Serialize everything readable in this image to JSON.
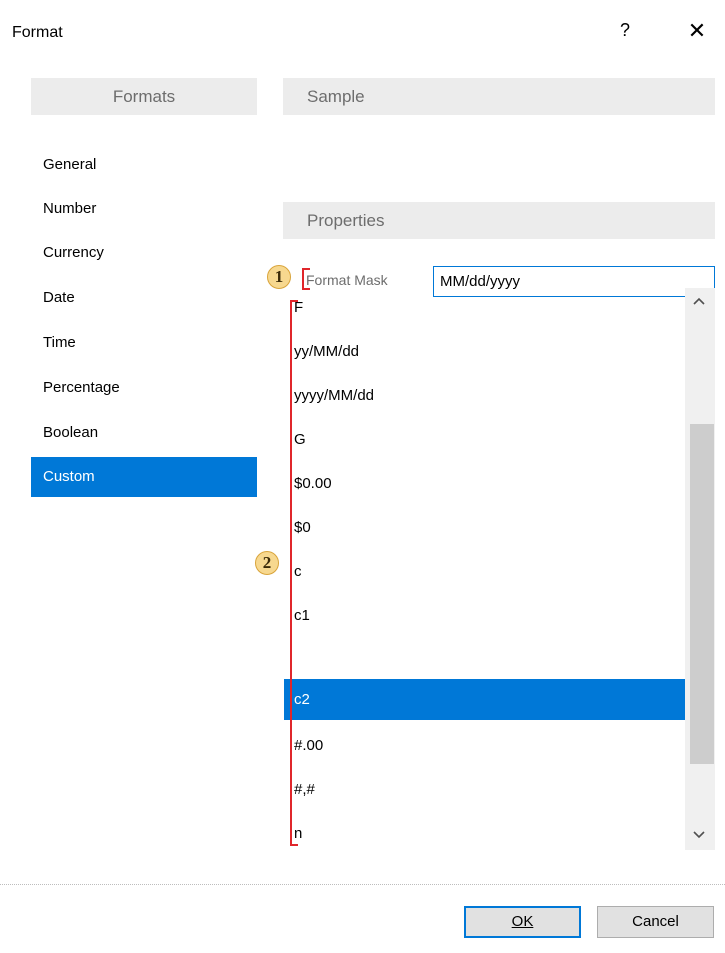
{
  "window": {
    "title": "Format",
    "help_label": "?",
    "close_label": "✕"
  },
  "formats": {
    "header": "Formats",
    "items": [
      "General",
      "Number",
      "Currency",
      "Date",
      "Time",
      "Percentage",
      "Boolean",
      "Custom"
    ],
    "selected": "Custom"
  },
  "sample": {
    "header": "Sample"
  },
  "properties": {
    "header": "Properties",
    "format_mask_label": "Format Mask",
    "format_mask_value": "MM/dd/yyyy"
  },
  "mask_list": {
    "items": [
      "F",
      "yy/MM/dd",
      "yyyy/MM/dd",
      "G",
      "$0.00",
      "$0",
      "c",
      "c1",
      "c2",
      "#.00",
      "#,#",
      "n"
    ],
    "selected": "c2"
  },
  "callouts": [
    "1",
    "2"
  ],
  "buttons": {
    "ok": "OK",
    "cancel": "Cancel"
  },
  "colors": {
    "accent": "#0078d7",
    "header_bg": "#ececec",
    "callout_bg": "#f7d88f",
    "bracket": "#e0262b"
  },
  "icons": {
    "scroll_up": "chevron-up-icon",
    "scroll_down": "chevron-down-icon",
    "close": "close-icon"
  }
}
